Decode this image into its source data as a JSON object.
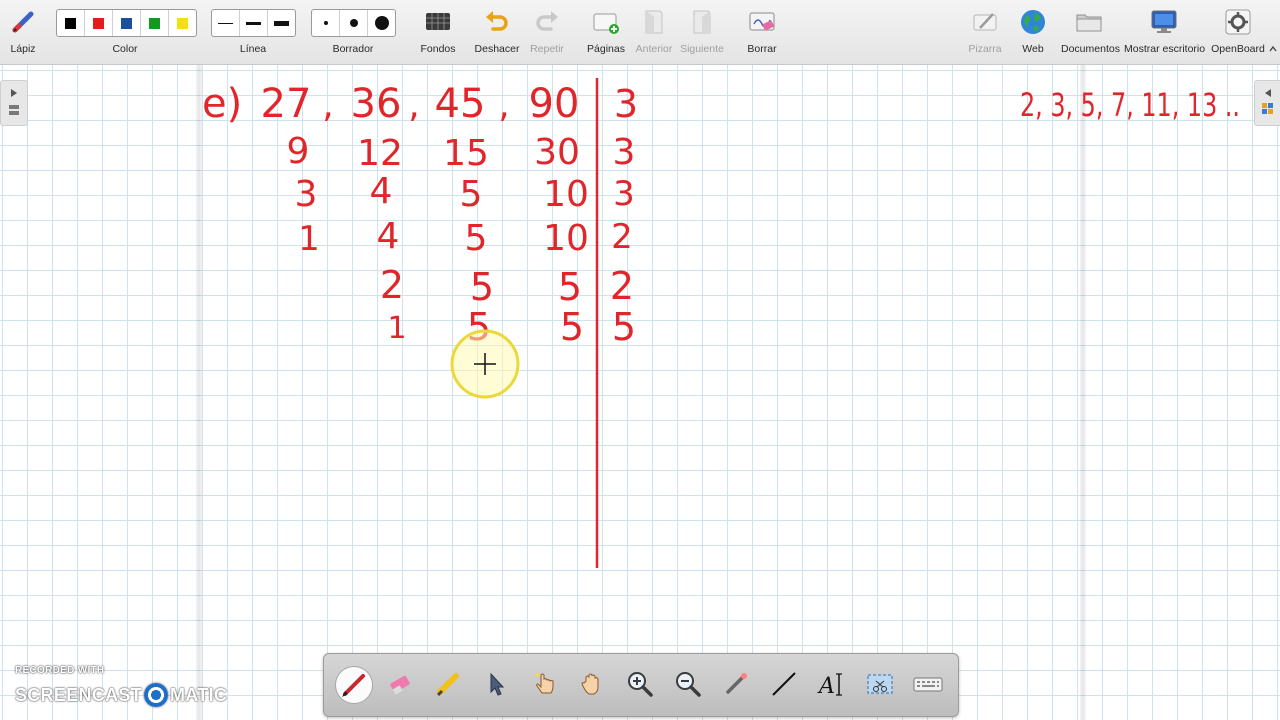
{
  "toolbar": {
    "pencil_label": "Lápiz",
    "color_label": "Color",
    "colors": [
      "#000000",
      "#e31b1b",
      "#1a4f9c",
      "#119a1f",
      "#f4df16"
    ],
    "line_label": "Línea",
    "eraser_label": "Borrador",
    "backgrounds_label": "Fondos",
    "undo_label": "Deshacer",
    "redo_label": "Repetir",
    "pages_label": "Páginas",
    "previous_label": "Anterior",
    "next_label": "Siguiente",
    "clear_label": "Borrar",
    "board_label": "Pizarra",
    "web_label": "Web",
    "documents_label": "Documentos",
    "desktop_label": "Mostrar escritorio",
    "app_label": "OpenBoard"
  },
  "board": {
    "ink_color": "#e0262b",
    "problem_label": "e)",
    "header_numbers": [
      "27",
      "36",
      "45",
      "90"
    ],
    "rows": [
      [
        "9",
        "12",
        "15",
        "30"
      ],
      [
        "3",
        "4",
        "5",
        "10"
      ],
      [
        "1",
        "4",
        "5",
        "10"
      ],
      [
        "",
        "2",
        "5",
        "5"
      ],
      [
        "",
        "1",
        "5",
        "5"
      ]
    ],
    "divisors": [
      "3",
      "3",
      "3",
      "2",
      "2",
      "5"
    ],
    "primes_note": "2, 3, 5, 7, 11, 13 ..",
    "cursor_icon": "crosshair-icon"
  },
  "palette": {
    "tools": [
      "pen-icon",
      "eraser-icon",
      "highlighter-icon",
      "selector-icon",
      "pointer-hand-icon",
      "pan-hand-icon",
      "zoom-in-icon",
      "zoom-out-icon",
      "laser-pointer-icon",
      "line-icon",
      "text-icon",
      "capture-icon",
      "keyboard-icon"
    ]
  },
  "watermark": {
    "top": "RECORDED WITH",
    "left": "SCREENCAST",
    "right": "MATIC"
  }
}
